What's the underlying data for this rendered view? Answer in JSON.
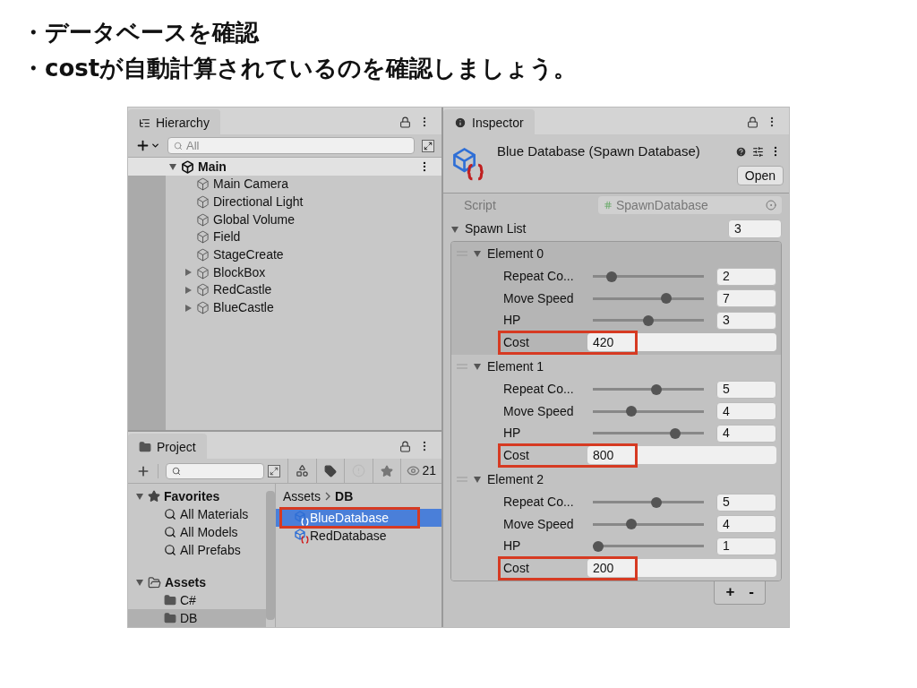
{
  "bullets": [
    "・データベースを確認",
    "・costが自動計算されているのを確認しましょう。"
  ],
  "hierarchy": {
    "tab": "Hierarchy",
    "search_placeholder": "All",
    "root": {
      "label": "Main",
      "expanded": true,
      "children": [
        {
          "label": "Main Camera",
          "expandable": false
        },
        {
          "label": "Directional Light",
          "expandable": false
        },
        {
          "label": "Global Volume",
          "expandable": false
        },
        {
          "label": "Field",
          "expandable": false
        },
        {
          "label": "StageCreate",
          "expandable": false
        },
        {
          "label": "BlockBox",
          "expandable": true
        },
        {
          "label": "RedCastle",
          "expandable": true
        },
        {
          "label": "BlueCastle",
          "expandable": true
        }
      ]
    }
  },
  "project": {
    "tab": "Project",
    "count": "21",
    "tree": [
      {
        "label": "Favorites",
        "kind": "favorites",
        "expanded": true,
        "children": [
          {
            "label": "All Materials"
          },
          {
            "label": "All Models"
          },
          {
            "label": "All Prefabs"
          }
        ]
      },
      {
        "label": "Assets",
        "kind": "folder",
        "expanded": true,
        "children": [
          {
            "label": "C#",
            "selected": false
          },
          {
            "label": "DB",
            "selected": true
          }
        ]
      }
    ],
    "breadcrumb": [
      "Assets",
      "DB"
    ],
    "files": [
      {
        "name": "BlueDatabase",
        "selected": true,
        "highlighted": true
      },
      {
        "name": "RedDatabase",
        "selected": false,
        "highlighted": false
      }
    ]
  },
  "inspector": {
    "tab": "Inspector",
    "title": "Blue Database (Spawn Database)",
    "open_button": "Open",
    "script_label": "Script",
    "script_value": "SpawnDatabase",
    "list_label": "Spawn List",
    "list_count": "3",
    "elements": [
      {
        "title": "Element 0",
        "selected": true,
        "fields": [
          {
            "kind": "slider",
            "label": "Repeat Co...",
            "level": 0.17,
            "value": "2"
          },
          {
            "kind": "slider",
            "label": "Move Speed",
            "level": 0.66,
            "value": "7"
          },
          {
            "kind": "slider",
            "label": "HP",
            "level": 0.5,
            "value": "3"
          },
          {
            "kind": "number",
            "label": "Cost",
            "value": "420",
            "highlighted": true
          }
        ]
      },
      {
        "title": "Element 1",
        "selected": false,
        "fields": [
          {
            "kind": "slider",
            "label": "Repeat Co...",
            "level": 0.57,
            "value": "5"
          },
          {
            "kind": "slider",
            "label": "Move Speed",
            "level": 0.35,
            "value": "4"
          },
          {
            "kind": "slider",
            "label": "HP",
            "level": 0.74,
            "value": "4"
          },
          {
            "kind": "number",
            "label": "Cost",
            "value": "800",
            "highlighted": true
          }
        ]
      },
      {
        "title": "Element 2",
        "selected": false,
        "fields": [
          {
            "kind": "slider",
            "label": "Repeat Co...",
            "level": 0.57,
            "value": "5"
          },
          {
            "kind": "slider",
            "label": "Move Speed",
            "level": 0.35,
            "value": "4"
          },
          {
            "kind": "slider",
            "label": "HP",
            "level": 0.05,
            "value": "1"
          },
          {
            "kind": "number",
            "label": "Cost",
            "value": "200",
            "highlighted": true
          }
        ]
      }
    ],
    "add_button": "+",
    "remove_button": "-"
  }
}
